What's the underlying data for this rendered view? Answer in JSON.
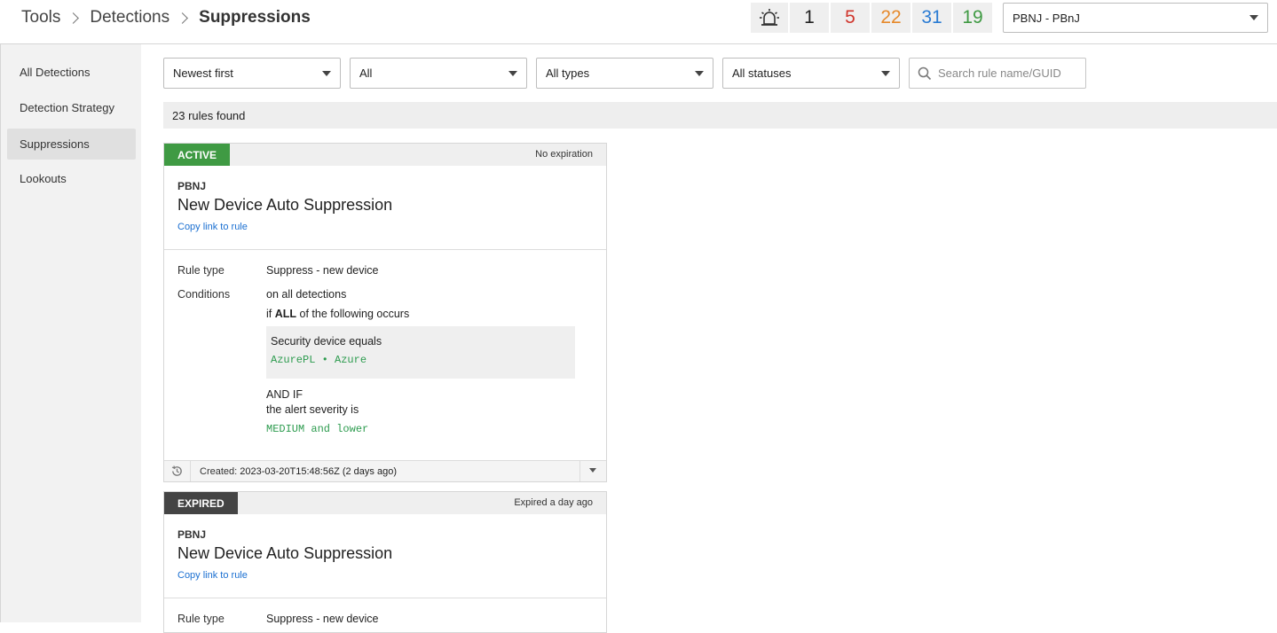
{
  "breadcrumb": [
    "Tools",
    "Detections",
    "Suppressions"
  ],
  "alert_counts": [
    {
      "value": "1",
      "color": "#222222"
    },
    {
      "value": "5",
      "color": "#d0352c"
    },
    {
      "value": "22",
      "color": "#e6892b"
    },
    {
      "value": "31",
      "color": "#2a7bd3"
    },
    {
      "value": "19",
      "color": "#3f9a43"
    }
  ],
  "account_selector": {
    "value": "PBNJ - PBnJ"
  },
  "sidebar": {
    "items": [
      {
        "label": "All Detections",
        "active": false
      },
      {
        "label": "Detection Strategy",
        "active": false
      },
      {
        "label": "Suppressions",
        "active": true
      },
      {
        "label": "Lookouts",
        "active": false
      }
    ]
  },
  "filters": {
    "sort": "Newest first",
    "scope": "All",
    "type": "All types",
    "status": "All statuses",
    "search_placeholder": "Search rule name/GUID"
  },
  "results_summary": "23 rules found",
  "cards": [
    {
      "status": "ACTIVE",
      "status_color": "#3f9a43",
      "expiry": "No expiration",
      "org": "PBNJ",
      "name": "New Device Auto Suppression",
      "link": "Copy link to rule",
      "rule_type_label": "Rule type",
      "rule_type": "Suppress - new device",
      "conditions_label": "Conditions",
      "cond_scope": "on all detections",
      "cond_if_prefix": "if ",
      "cond_if_keyword": "ALL",
      "cond_if_suffix": " of the following occurs",
      "cond_box_title": "Security device equals",
      "cond_box_value": "AzurePL • Azure",
      "and_if": "AND IF",
      "severity_text": "the alert severity is",
      "severity_value": "MEDIUM and lower",
      "created_label": "Created:",
      "created_value": "2023-03-20T15:48:56Z (2 days ago)"
    },
    {
      "status": "EXPIRED",
      "status_color": "#444444",
      "expiry": "Expired a day ago",
      "org": "PBNJ",
      "name": "New Device Auto Suppression",
      "link": "Copy link to rule",
      "rule_type_label": "Rule type",
      "rule_type": "Suppress - new device"
    }
  ]
}
